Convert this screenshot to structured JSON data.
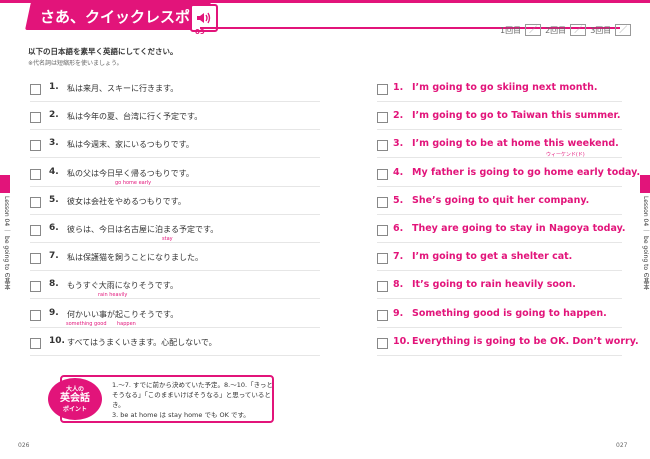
{
  "header": {
    "title": "さあ、クイックレスポンス！",
    "track": "09"
  },
  "progress": [
    {
      "label": "1回目",
      "mark": "／"
    },
    {
      "label": "2回目",
      "mark": "／"
    },
    {
      "label": "3回目",
      "mark": "／"
    }
  ],
  "instructions": {
    "main": "以下の日本語を素早く英語にしてください。",
    "note": "※代名詞は短縮形を使いましょう。"
  },
  "left_items": [
    {
      "num": "1.",
      "ja": "私は来月、スキーに行きます。"
    },
    {
      "num": "2.",
      "ja": "私は今年の夏、台湾に行く予定です。"
    },
    {
      "num": "3.",
      "ja": "私は今週末、家にいるつもりです。"
    },
    {
      "num": "4.",
      "ja": "私の父は今日早く帰るつもりです。",
      "hint": "go home early"
    },
    {
      "num": "5.",
      "ja": "彼女は会社をやめるつもりです。"
    },
    {
      "num": "6.",
      "ja": "彼らは、今日は名古屋に泊まる予定です。",
      "hint": "stay"
    },
    {
      "num": "7.",
      "ja": "私は保護猫を飼うことになりました。"
    },
    {
      "num": "8.",
      "ja": "もうすぐ大雨になりそうです。",
      "hint": "rain heavily"
    },
    {
      "num": "9.",
      "ja": "何かいい事が起こりそうです。",
      "hint": "something good",
      "hint2": "happen"
    },
    {
      "num": "10.",
      "ja": "すべてはうまくいきます。心配しないで。"
    }
  ],
  "right_items": [
    {
      "num": "1.",
      "en": "I’m going to go skiing next month."
    },
    {
      "num": "2.",
      "en": "I’m going to go to Taiwan this summer."
    },
    {
      "num": "3.",
      "en": "I’m going to be at home this weekend.",
      "note": "ウィーケンド(ド)"
    },
    {
      "num": "4.",
      "en": "My father is going to go home early today."
    },
    {
      "num": "5.",
      "en": "She’s going to quit her company."
    },
    {
      "num": "6.",
      "en": "They are going to stay in Nagoya today."
    },
    {
      "num": "7.",
      "en": "I’m going to get a shelter cat."
    },
    {
      "num": "8.",
      "en": "It’s going to rain heavily soon."
    },
    {
      "num": "9.",
      "en": "Something good is going to happen."
    },
    {
      "num": "10.",
      "en": "Everything is going to be OK. Don’t worry."
    }
  ],
  "side": {
    "left": "Lesson 04 ｜ be going to の基本",
    "right": "Lesson 04 ｜ be going to の基本"
  },
  "point": {
    "badge_line1": "大人の",
    "badge_line2": "英会話",
    "badge_line3": "ポイント",
    "line1": "1.～7. すでに前から決めていた予定。8.～10.「きっと",
    "line2": "そうなる」「このままいけばそうなる」と思っているとき。",
    "line3": "3. be at home は stay home でも OK です。"
  },
  "pages": {
    "left": "026",
    "right": "027"
  },
  "colors": {
    "accent": "#e2147a"
  }
}
